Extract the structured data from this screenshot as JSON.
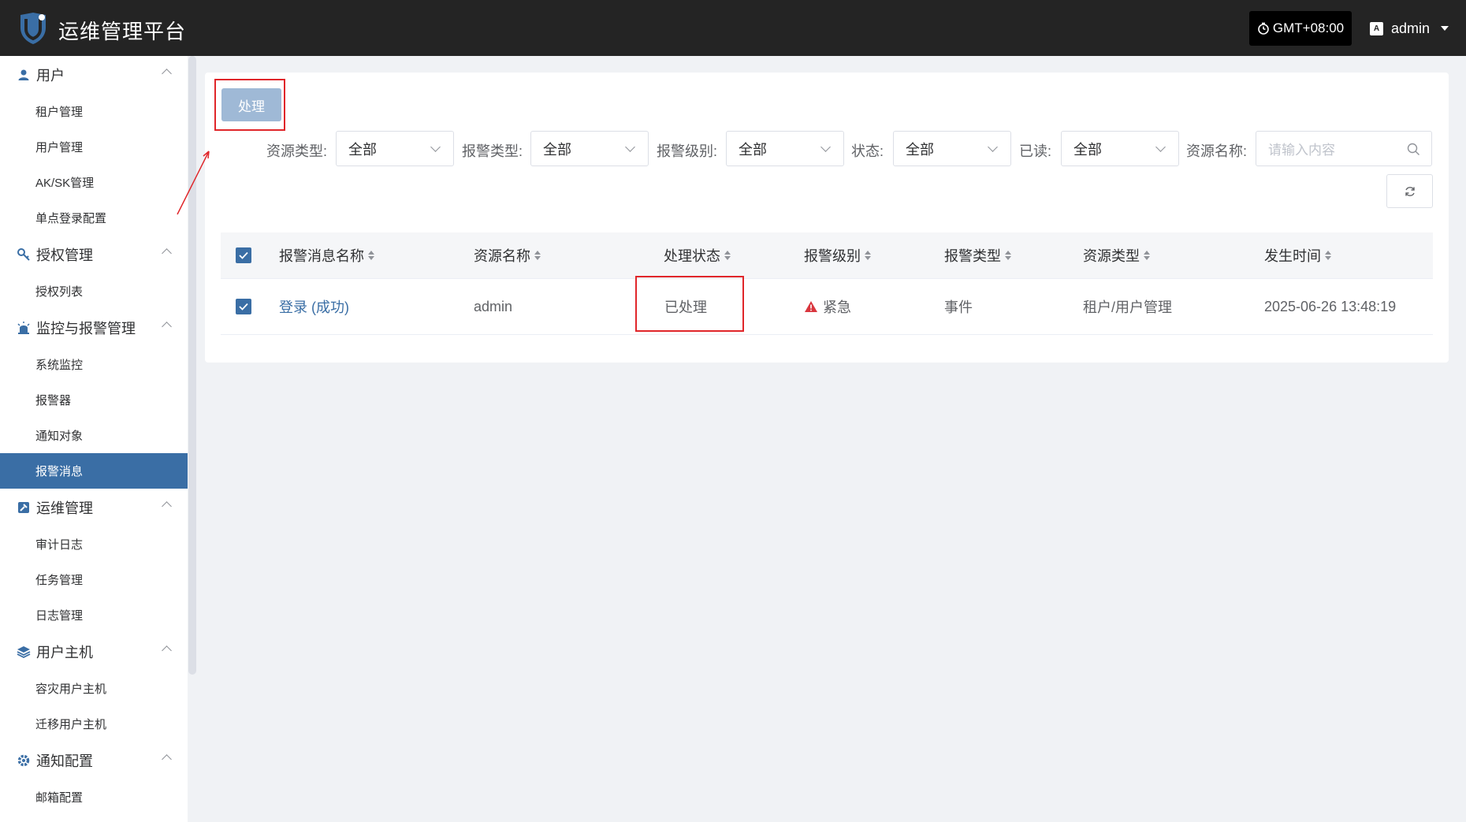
{
  "header": {
    "app_title": "运维管理平台",
    "timezone": "GMT+08:00",
    "user": "admin"
  },
  "sidebar": {
    "groups": [
      {
        "label": "用户",
        "icon": "user-icon",
        "items": [
          "租户管理",
          "用户管理",
          "AK/SK管理",
          "单点登录配置"
        ]
      },
      {
        "label": "授权管理",
        "icon": "key-icon",
        "items": [
          "授权列表"
        ]
      },
      {
        "label": "监控与报警管理",
        "icon": "alarm-icon",
        "items": [
          "系统监控",
          "报警器",
          "通知对象",
          "报警消息"
        ]
      },
      {
        "label": "运维管理",
        "icon": "ops-icon",
        "items": [
          "审计日志",
          "任务管理",
          "日志管理"
        ]
      },
      {
        "label": "用户主机",
        "icon": "layers-icon",
        "items": [
          "容灾用户主机",
          "迁移用户主机"
        ]
      },
      {
        "label": "通知配置",
        "icon": "gear-icon",
        "items": [
          "邮箱配置"
        ]
      }
    ],
    "active_item": "报警消息"
  },
  "toolbar": {
    "process_label": "处理"
  },
  "filters": {
    "resource_type": {
      "label": "资源类型:",
      "value": "全部"
    },
    "alert_type": {
      "label": "报警类型:",
      "value": "全部"
    },
    "alert_level": {
      "label": "报警级别:",
      "value": "全部"
    },
    "status": {
      "label": "状态:",
      "value": "全部"
    },
    "read": {
      "label": "已读:",
      "value": "全部"
    },
    "resource_name": {
      "label": "资源名称:",
      "placeholder": "请输入内容"
    }
  },
  "table": {
    "columns": [
      "报警消息名称",
      "资源名称",
      "处理状态",
      "报警级别",
      "报警类型",
      "资源类型",
      "发生时间"
    ],
    "rows": [
      {
        "name": "登录 (成功)",
        "resource": "admin",
        "status": "已处理",
        "level": "紧急",
        "type": "事件",
        "resource_type": "租户/用户管理",
        "time": "2025-06-26 13:48:19"
      }
    ]
  },
  "colors": {
    "accent": "#3a6ea5",
    "highlight": "#e0262a",
    "header_bg": "#242424",
    "danger": "#d9363e"
  }
}
